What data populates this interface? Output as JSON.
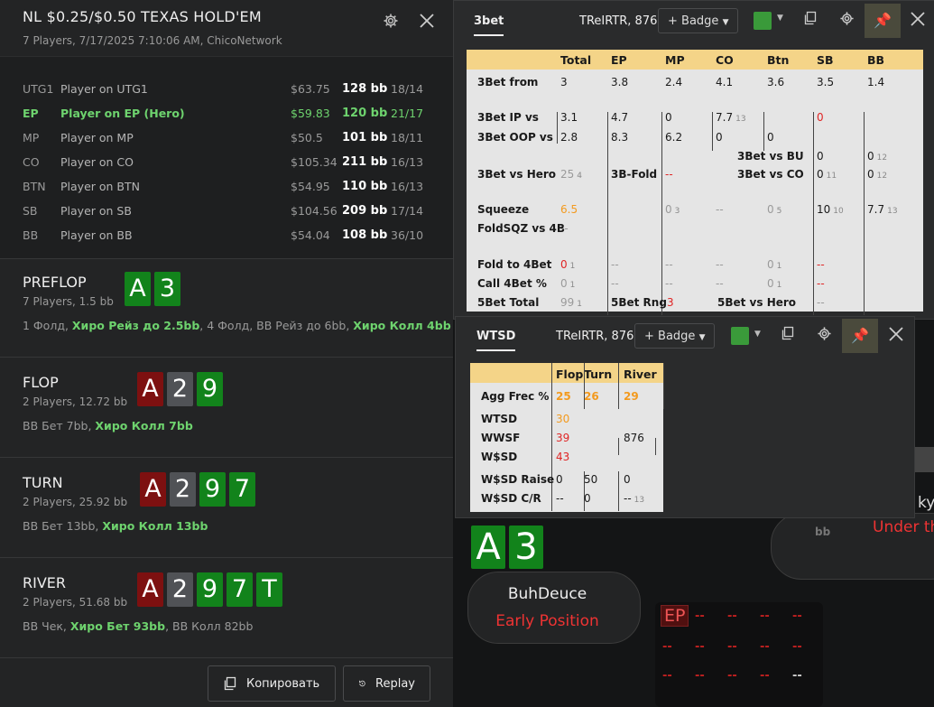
{
  "hand": {
    "title": "NL $0.25/$0.50 TEXAS HOLD'EM",
    "subtitle": "7 Players, 7/17/2025 7:10:06 AM, ChicoNetwork",
    "players": [
      {
        "pos": "UTG1",
        "name": "Player on UTG1",
        "stack": "$63.75",
        "bb": "128 bb",
        "vp": "18/14",
        "hero": false
      },
      {
        "pos": "EP",
        "name": "Player on EP (Hero)",
        "stack": "$59.83",
        "bb": "120 bb",
        "vp": "21/17",
        "hero": true
      },
      {
        "pos": "MP",
        "name": "Player on MP",
        "stack": "$50.5",
        "bb": "101 bb",
        "vp": "18/11",
        "hero": false
      },
      {
        "pos": "CO",
        "name": "Player on CO",
        "stack": "$105.34",
        "bb": "211 bb",
        "vp": "16/13",
        "hero": false
      },
      {
        "pos": "BTN",
        "name": "Player on BTN",
        "stack": "$54.95",
        "bb": "110 bb",
        "vp": "16/13",
        "hero": false
      },
      {
        "pos": "SB",
        "name": "Player on SB",
        "stack": "$104.56",
        "bb": "209 bb",
        "vp": "17/14",
        "hero": false
      },
      {
        "pos": "BB",
        "name": "Player on BB",
        "stack": "$54.04",
        "bb": "108 bb",
        "vp": "36/10",
        "hero": false
      }
    ],
    "streets": [
      {
        "name": "PREFLOP",
        "info": "7 Players, 1.5 bb",
        "cards": [
          {
            "r": "A",
            "c": "green"
          },
          {
            "r": "3",
            "c": "green"
          }
        ],
        "actions": [
          {
            "t": "1 Фолд, ",
            "h": false
          },
          {
            "t": "Хиро Рейз до 2.5bb",
            "h": true
          },
          {
            "t": ", 4 Фолд, BB Рейз до 6bb, ",
            "h": false
          },
          {
            "t": "Хиро Колл 4bb",
            "h": true
          }
        ]
      },
      {
        "name": "FLOP",
        "info": "2 Players, 12.72 bb",
        "cards": [
          {
            "r": "A",
            "c": "red"
          },
          {
            "r": "2",
            "c": "gray"
          },
          {
            "r": "9",
            "c": "green"
          }
        ],
        "actions": [
          {
            "t": "BB Бет 7bb, ",
            "h": false
          },
          {
            "t": "Хиро Колл 7bb",
            "h": true
          }
        ]
      },
      {
        "name": "TURN",
        "info": "2 Players, 25.92 bb",
        "cards": [
          {
            "r": "A",
            "c": "red"
          },
          {
            "r": "2",
            "c": "gray"
          },
          {
            "r": "9",
            "c": "green"
          },
          {
            "r": "7",
            "c": "green"
          }
        ],
        "actions": [
          {
            "t": "BB Бет 13bb, ",
            "h": false
          },
          {
            "t": "Хиро Колл 13bb",
            "h": true
          }
        ]
      },
      {
        "name": "RIVER",
        "info": "2 Players, 51.68 bb",
        "cards": [
          {
            "r": "A",
            "c": "red"
          },
          {
            "r": "2",
            "c": "gray"
          },
          {
            "r": "9",
            "c": "green"
          },
          {
            "r": "7",
            "c": "green"
          },
          {
            "r": "T",
            "c": "green"
          }
        ],
        "actions": [
          {
            "t": "BB Чек, ",
            "h": false
          },
          {
            "t": "Хиро Бет 93bb",
            "h": true
          },
          {
            "t": ", BB Колл 82bb",
            "h": false
          }
        ]
      }
    ],
    "copy_label": "Копировать",
    "replay_label": "Replay"
  },
  "hud1": {
    "tab": "3bet",
    "player": "TReIRTR, 876",
    "badge": "+ Badge",
    "badge_color": "#3a9a3a",
    "headers": [
      "Total",
      "EP",
      "MP",
      "CO",
      "Btn",
      "SB",
      "BB"
    ],
    "rows": [
      {
        "label": "3Bet from",
        "vals": [
          "3",
          "3.8",
          "2.4",
          "4.1",
          "3.6",
          "3.5",
          "1.4"
        ]
      },
      {
        "label": "3Bet IP vs",
        "vals": [
          "3.1",
          "4.7",
          "0",
          "7.7",
          "",
          "0",
          ""
        ],
        "sub": {
          "3": "13"
        }
      },
      {
        "label": "3Bet OOP vs",
        "vals": [
          "2.8",
          "8.3",
          "6.2",
          "0",
          "0",
          "",
          ""
        ]
      },
      {
        "label": "3Bet vs BU",
        "vals": [
          "0",
          "0"
        ],
        "sub2": "12"
      },
      {
        "label": "3Bet vs Hero",
        "vals": [
          "25"
        ],
        "sub": "4"
      },
      {
        "label": "3B-Fold",
        "vals": [
          "--"
        ]
      },
      {
        "label": "3Bet vs CO",
        "vals": [
          "0",
          "0"
        ],
        "subs": [
          "11",
          "12"
        ]
      },
      {
        "label": "Squeeze",
        "vals": [
          "6.5",
          "0",
          "--",
          "0",
          "10",
          "7.7"
        ],
        "subs": [
          "",
          "3",
          "",
          "5",
          "10",
          "13"
        ]
      },
      {
        "label": "FoldSQZ vs 4B",
        "vals": [
          "--"
        ]
      },
      {
        "label": "Fold to 4Bet",
        "vals": [
          "0",
          "--",
          "--",
          "--",
          "0",
          "--"
        ],
        "subs": [
          "1",
          "",
          "",
          "",
          "1",
          ""
        ]
      },
      {
        "label": "Call 4Bet %",
        "vals": [
          "0",
          "--",
          "--",
          "--",
          "0",
          "--"
        ],
        "subs": [
          "1",
          "",
          "",
          "",
          "1",
          ""
        ]
      },
      {
        "label": "5Bet Total",
        "vals": [
          "99"
        ],
        "subs": [
          "1"
        ]
      },
      {
        "label": "5Bet Rng",
        "vals": [
          "3"
        ]
      },
      {
        "label": "5Bet vs Hero",
        "vals": [
          "--"
        ]
      }
    ]
  },
  "hud2": {
    "tab": "WTSD",
    "player": "TReIRTR, 876",
    "badge": "+ Badge",
    "headers": [
      "Flop",
      "Turn",
      "River"
    ],
    "agg": {
      "label": "Agg Frec %",
      "vals": [
        "25",
        "26",
        "29"
      ]
    },
    "rows": [
      {
        "label": "WTSD",
        "val": "30"
      },
      {
        "label": "WWSF",
        "val": "39",
        "extra": "876"
      },
      {
        "label": "W$SD",
        "val": "43"
      }
    ],
    "raise": {
      "label": "W$SD Raise",
      "vals": [
        "0",
        "50",
        "0"
      ]
    },
    "cr": {
      "label": "W$SD C/R",
      "vals": [
        "--",
        "0",
        "--"
      ],
      "sub": "13"
    }
  },
  "table": {
    "hero_cards": [
      {
        "r": "A",
        "c": "green"
      },
      {
        "r": "3",
        "c": "green"
      }
    ],
    "hero_name": "BuhDeuce",
    "hero_pos": "Early Position",
    "opp_bb": "bb",
    "opp_status": "Under th",
    "opp_name_partial": "kyM",
    "ep_badge": "EP",
    "dashes": "--"
  }
}
